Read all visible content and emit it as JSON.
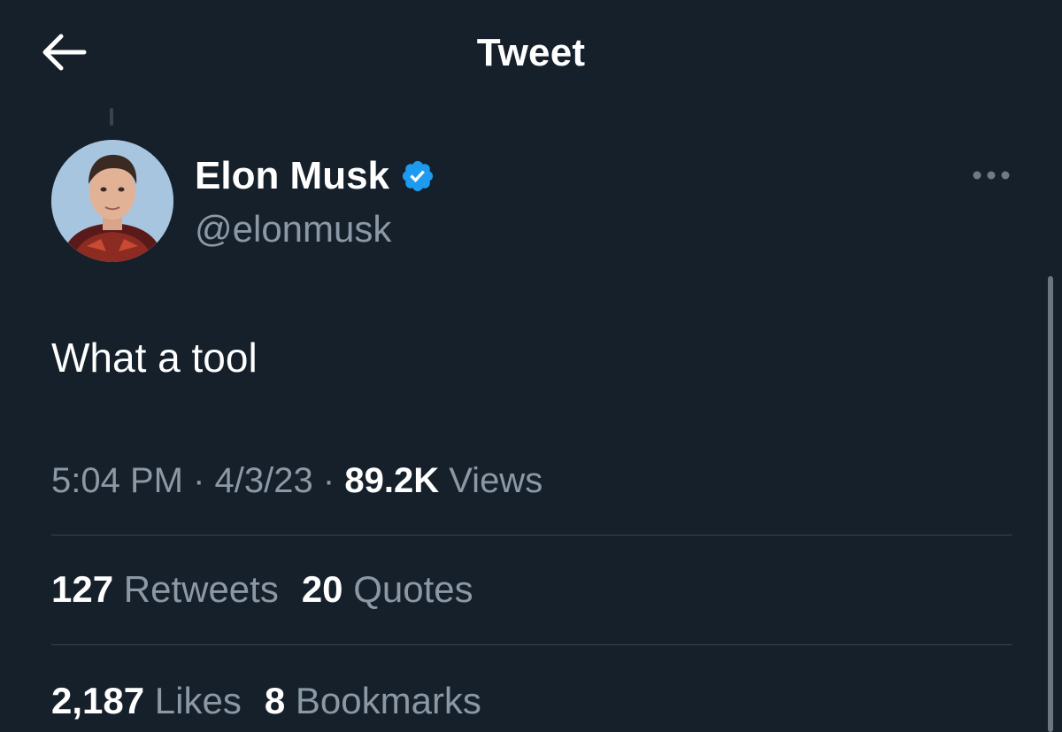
{
  "header": {
    "title": "Tweet",
    "back_icon": "arrow-left-icon"
  },
  "author": {
    "display_name": "Elon Musk",
    "handle": "@elonmusk",
    "verified": true,
    "verified_icon": "verified-badge-icon"
  },
  "tweet": {
    "text": "What a tool",
    "time": "5:04 PM",
    "separator": "·",
    "date": "4/3/23",
    "views_count": "89.2K",
    "views_label": "Views",
    "more_icon": "more-horizontal-icon"
  },
  "stats": {
    "retweets_count": "127",
    "retweets_label": "Retweets",
    "quotes_count": "20",
    "quotes_label": "Quotes",
    "likes_count": "2,187",
    "likes_label": "Likes",
    "bookmarks_count": "8",
    "bookmarks_label": "Bookmarks"
  },
  "colors": {
    "background": "#15202b",
    "text_primary": "#ffffff",
    "text_secondary": "#8b98a5",
    "divider": "#38444d",
    "verified": "#1d9bf0"
  }
}
